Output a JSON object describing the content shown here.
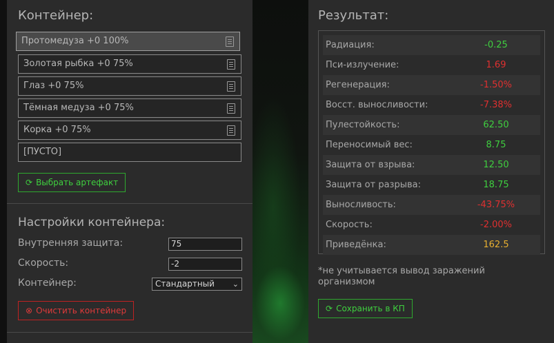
{
  "container": {
    "title": "Контейнер:",
    "slots": [
      "Протомедуза +0 100%",
      "Золотая рыбка +0 75%",
      "Глаз +0 75%",
      "Тёмная медуза +0 75%",
      "Корка +0 75%",
      "[ПУСТО]"
    ],
    "choose_button": "Выбрать артефакт"
  },
  "settings": {
    "title": "Настройки контейнера:",
    "inner_protection_label": "Внутренняя защита:",
    "inner_protection_value": "75",
    "speed_label": "Скорость:",
    "speed_value": "-2",
    "container_label": "Контейнер:",
    "container_selected": "Стандартный",
    "clear_button": "Очистить контейнер"
  },
  "result": {
    "title": "Результат:",
    "rows": [
      {
        "label": "Радиация:",
        "value": "-0.25",
        "color": "#3fcf3f"
      },
      {
        "label": "Пси-излучение:",
        "value": "1.69",
        "color": "#e03030"
      },
      {
        "label": "Регенерация:",
        "value": "-1.50%",
        "color": "#e03030"
      },
      {
        "label": "Восст. выносливости:",
        "value": "-7.38%",
        "color": "#e03030"
      },
      {
        "label": "Пулестойкость:",
        "value": "62.50",
        "color": "#3fcf3f"
      },
      {
        "label": "Переносимый вес:",
        "value": "8.75",
        "color": "#3fcf3f"
      },
      {
        "label": "Защита от взрыва:",
        "value": "12.50",
        "color": "#3fcf3f"
      },
      {
        "label": "Защита от разрыва:",
        "value": "18.75",
        "color": "#3fcf3f"
      },
      {
        "label": "Выносливость:",
        "value": "-43.75%",
        "color": "#e03030"
      },
      {
        "label": "Скорость:",
        "value": "-2.00%",
        "color": "#e03030"
      },
      {
        "label": "Приведёнка:",
        "value": "162.5",
        "color": "#e8b030"
      }
    ],
    "note": "*не учитывается вывод заражений организмом",
    "save_button": "Сохранить в КП"
  },
  "icons": {
    "slot_icon": "document-icon",
    "refresh_icon": "refresh-icon",
    "clear_icon": "cancel-circle-icon"
  }
}
